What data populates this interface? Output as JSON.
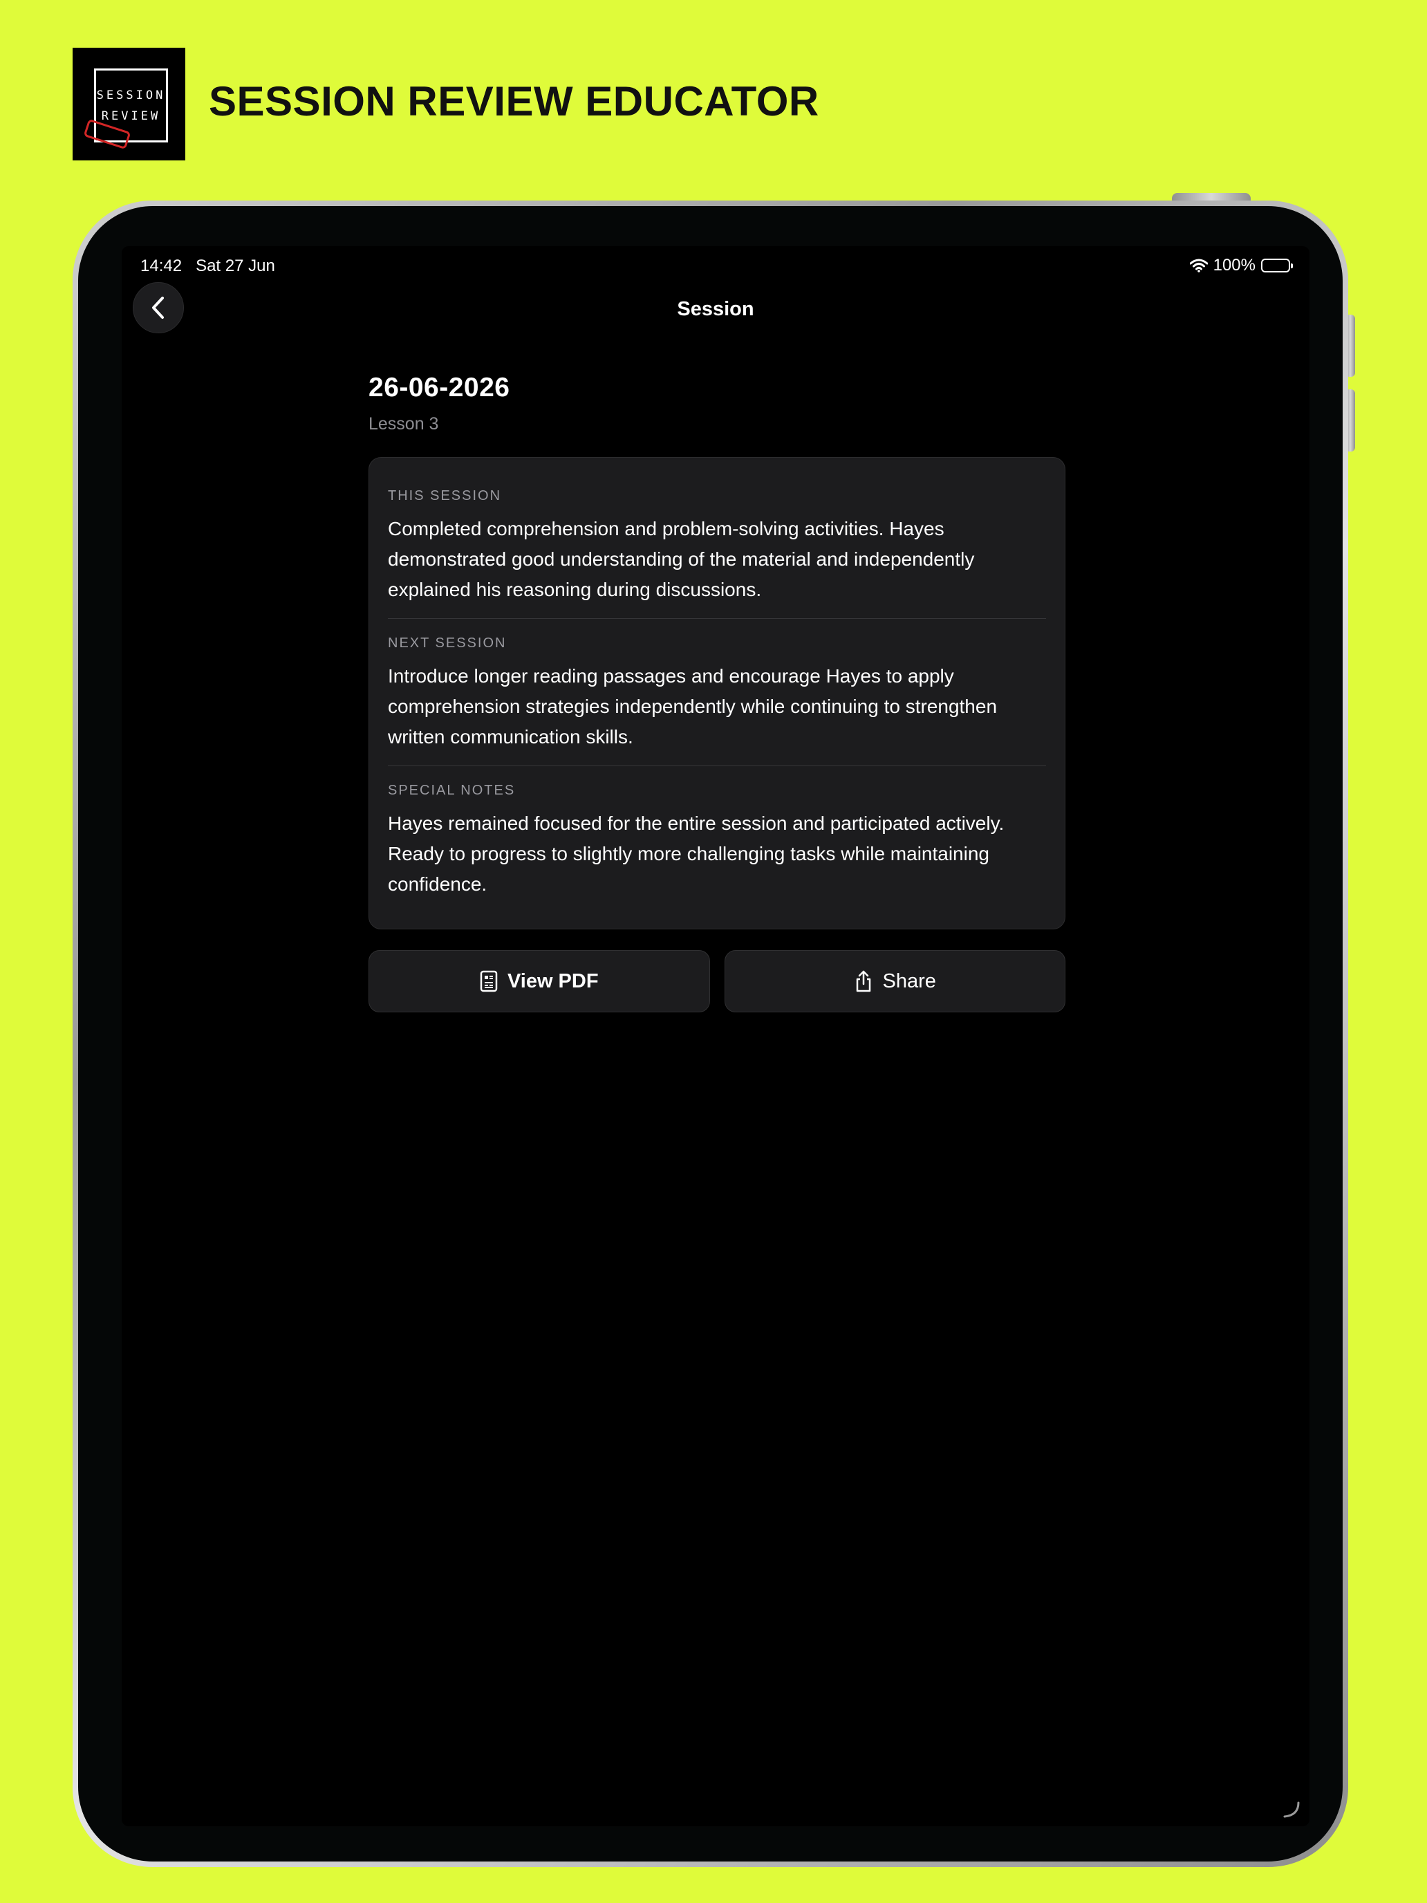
{
  "promo": {
    "logo_line1": "SESSION",
    "logo_line2": "REVIEW",
    "title": "SESSION REVIEW EDUCATOR"
  },
  "status_bar": {
    "time": "14:42",
    "date": "Sat 27 Jun",
    "battery": "100%"
  },
  "nav": {
    "title": "Session",
    "back_icon": "chevron-left-icon"
  },
  "session": {
    "date": "26-06-2026",
    "lesson": "Lesson 3",
    "sections": [
      {
        "label": "THIS SESSION",
        "text": "Completed comprehension and problem-solving activities. Hayes demonstrated good understanding of the material and independently explained his reasoning during discussions."
      },
      {
        "label": "NEXT SESSION",
        "text": "Introduce longer reading passages and encourage Hayes to apply comprehension strategies independently while continuing to strengthen written communication skills."
      },
      {
        "label": "SPECIAL NOTES",
        "text": "Hayes remained focused for the entire session and participated actively. Ready to progress to slightly more challenging tasks while maintaining confidence."
      }
    ]
  },
  "actions": {
    "view_pdf": "View PDF",
    "share": "Share"
  },
  "colors": {
    "background": "#dffb3a",
    "screen": "#000000",
    "card": "#1c1c1e",
    "secondary_text": "#8d8d92"
  }
}
